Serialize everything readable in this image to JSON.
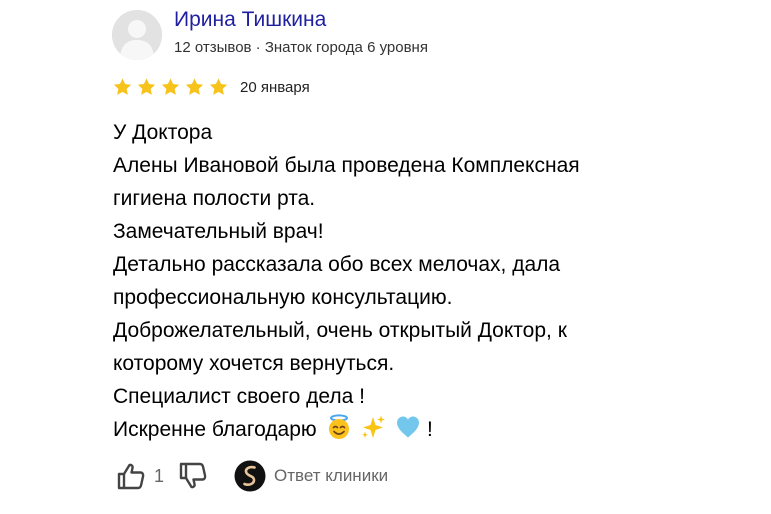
{
  "author": {
    "name": "Ирина Тишкина",
    "meta": "12 отзывов · Знаток города 6 уровня"
  },
  "rating": {
    "value": 5,
    "max": 5,
    "date": "20 января",
    "star_color": "#f6c21c"
  },
  "review": {
    "lines": [
      "У Доктора",
      "Алены Ивановой была проведена Комплексная",
      "гигиена полости рта.",
      "Замечательный врач!",
      "Детально рассказала обо всех мелочах, дала",
      "профессиональную консультацию.",
      "Доброжелательный, очень открытый Доктор, к",
      "которому хочется вернуться.",
      "Специалист своего дела !"
    ],
    "last_line_text": "Искренне благодарю",
    "last_line_end": "!",
    "emojis": [
      "smiling-face-with-halo",
      "sparkles",
      "light-blue-heart"
    ]
  },
  "actions": {
    "like_count": "1",
    "reply_label": "Ответ клиники"
  },
  "colors": {
    "author_name": "#1f1fa0",
    "secondary_text": "#666666"
  }
}
